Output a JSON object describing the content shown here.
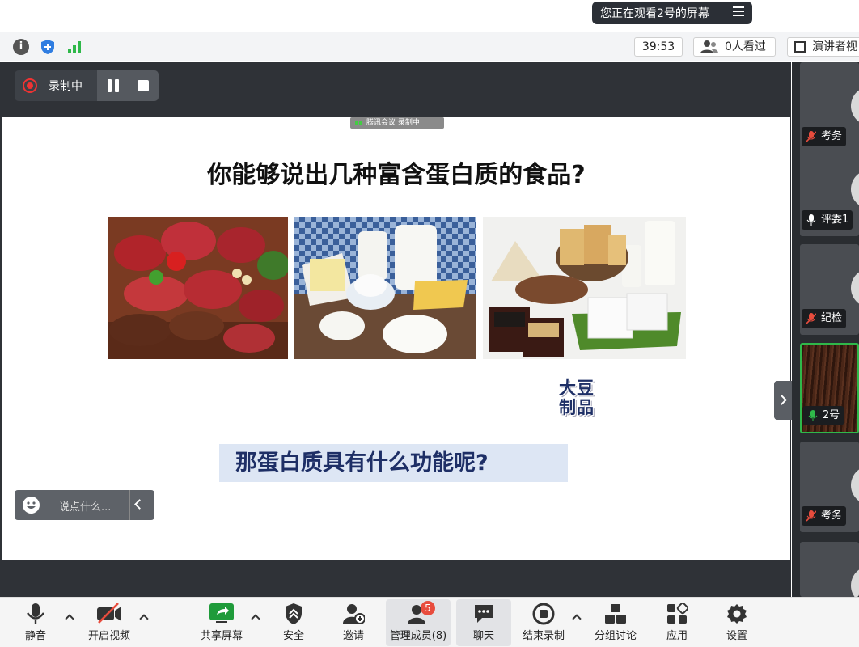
{
  "top": {
    "viewing_status": "您正在观看2号的屏幕"
  },
  "info_bar": {
    "info_icon_glyph": "i",
    "timer": "39:53",
    "viewers": "0人看过",
    "presenter_view": "演讲者视"
  },
  "recording": {
    "label": "录制中"
  },
  "slide": {
    "watermark": "腾讯会议 录制中",
    "title": "你能够说出几种富含蛋白质的食品?",
    "soy_label_line1": "大豆",
    "soy_label_line2": "制品",
    "question": "那蛋白质具有什么功能呢?"
  },
  "chat": {
    "placeholder": "说点什么..."
  },
  "participants": [
    {
      "name": "考务",
      "muted": true
    },
    {
      "name": "评委1",
      "muted": false
    },
    {
      "name": "纪检",
      "muted": true
    },
    {
      "name": "2号",
      "muted": false,
      "active": true
    },
    {
      "name": "考务",
      "muted": true
    }
  ],
  "toolbar": {
    "mute": "静音",
    "video": "开启视频",
    "share": "共享屏幕",
    "security": "安全",
    "invite": "邀请",
    "members": "管理成员(8)",
    "members_badge": "5",
    "chat": "聊天",
    "end_record": "结束录制",
    "breakout": "分组讨论",
    "apps": "应用",
    "settings": "设置"
  },
  "colors": {
    "stage_bg": "#2f3237",
    "active_border": "#2fb84a",
    "record_red": "#e33333",
    "badge_red": "#e84c3d",
    "title_navy": "#1e2f66"
  }
}
